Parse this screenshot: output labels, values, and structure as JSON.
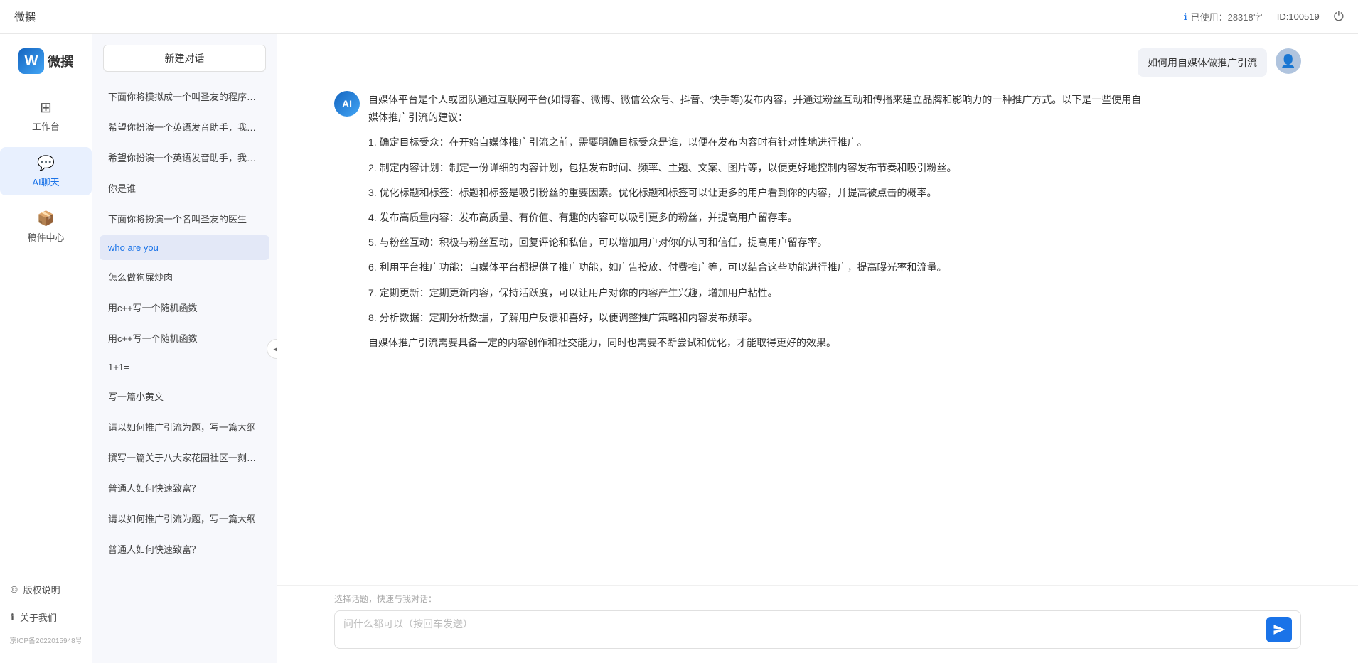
{
  "topbar": {
    "title": "微撰",
    "usage_label": "已使用：28318字",
    "id_label": "ID:100519",
    "usage_icon": "ℹ",
    "power_icon": "⏻"
  },
  "left_nav": {
    "logo_letter": "W",
    "logo_text": "微撰",
    "items": [
      {
        "id": "workbench",
        "icon": "⊞",
        "label": "工作台",
        "active": false
      },
      {
        "id": "ai-chat",
        "icon": "💬",
        "label": "AI聊天",
        "active": true
      },
      {
        "id": "components",
        "icon": "📦",
        "label": "稿件中心",
        "active": false
      }
    ],
    "footer_items": [
      {
        "id": "copyright",
        "icon": "©",
        "label": "版权说明"
      },
      {
        "id": "about",
        "icon": "ℹ",
        "label": "关于我们"
      }
    ],
    "beian": "京ICP备2022015948号"
  },
  "history": {
    "new_chat_label": "新建对话",
    "items": [
      {
        "id": "h1",
        "text": "下面你将模拟成一个叫圣友的程序员，我说...",
        "active": false
      },
      {
        "id": "h2",
        "text": "希望你扮演一个英语发音助手，我提供给你...",
        "active": false
      },
      {
        "id": "h3",
        "text": "希望你扮演一个英语发音助手，我提供给你...",
        "active": false
      },
      {
        "id": "h4",
        "text": "你是谁",
        "active": false
      },
      {
        "id": "h5",
        "text": "下面你将扮演一个名叫圣友的医生",
        "active": false
      },
      {
        "id": "h6",
        "text": "who are you",
        "active": true
      },
      {
        "id": "h7",
        "text": "怎么做狗屎炒肉",
        "active": false
      },
      {
        "id": "h8",
        "text": "用c++写一个随机函数",
        "active": false
      },
      {
        "id": "h9",
        "text": "用c++写一个随机函数",
        "active": false
      },
      {
        "id": "h10",
        "text": "1+1=",
        "active": false
      },
      {
        "id": "h11",
        "text": "写一篇小黄文",
        "active": false
      },
      {
        "id": "h12",
        "text": "请以如何推广引流为题，写一篇大纲",
        "active": false
      },
      {
        "id": "h13",
        "text": "撰写一篇关于八大家花园社区一刻钟便民生...",
        "active": false
      },
      {
        "id": "h14",
        "text": "普通人如何快速致富？",
        "active": false
      },
      {
        "id": "h15",
        "text": "请以如何推广引流为题，写一篇大纲",
        "active": false
      },
      {
        "id": "h16",
        "text": "普通人如何快速致富？",
        "active": false
      }
    ]
  },
  "chat": {
    "user_question": "如何用自媒体做推广引流",
    "ai_response": {
      "paragraphs": [
        "自媒体平台是个人或团队通过互联网平台(如博客、微博、微信公众号、抖音、快手等)发布内容，并通过粉丝互动和传播来建立品牌和影响力的一种推广方式。以下是一些使用自媒体推广引流的建议：",
        "1. 确定目标受众：在开始自媒体推广引流之前，需要明确目标受众是谁，以便在发布内容时有针对性地进行推广。",
        "2. 制定内容计划：制定一份详细的内容计划，包括发布时间、频率、主题、文案、图片等，以便更好地控制内容发布节奏和吸引粉丝。",
        "3. 优化标题和标签：标题和标签是吸引粉丝的重要因素。优化标题和标签可以让更多的用户看到你的内容，并提高被点击的概率。",
        "4. 发布高质量内容：发布高质量、有价值、有趣的内容可以吸引更多的粉丝，并提高用户留存率。",
        "5. 与粉丝互动：积极与粉丝互动，回复评论和私信，可以增加用户对你的认可和信任，提高用户留存率。",
        "6. 利用平台推广功能：自媒体平台都提供了推广功能，如广告投放、付费推广等，可以结合这些功能进行推广，提高曝光率和流量。",
        "7. 定期更新：定期更新内容，保持活跃度，可以让用户对你的内容产生兴趣，增加用户粘性。",
        "8. 分析数据：定期分析数据，了解用户反馈和喜好，以便调整推广策略和内容发布频率。",
        "自媒体推广引流需要具备一定的内容创作和社交能力，同时也需要不断尝试和优化，才能取得更好的效果。"
      ]
    },
    "quick_topics_label": "选择话题，快速与我对话：",
    "input_placeholder": "问什么都可以（按回车发送）"
  }
}
